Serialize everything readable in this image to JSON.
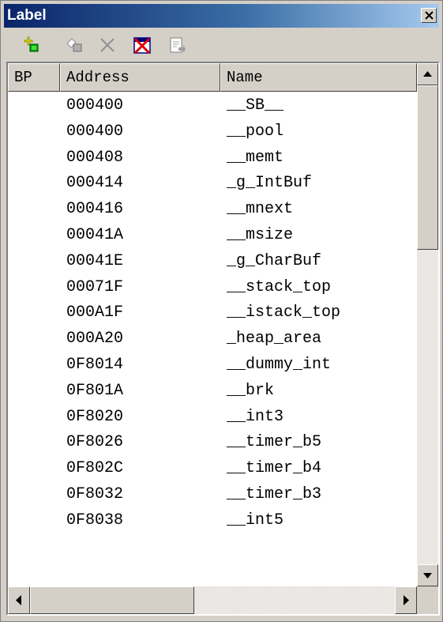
{
  "window": {
    "title": "Label"
  },
  "toolbar": {
    "icons": [
      "add-label-icon",
      "edit-label-icon",
      "delete-label-icon",
      "delete-all-icon",
      "export-icon"
    ]
  },
  "table": {
    "columns": [
      "BP",
      "Address",
      "Name"
    ],
    "rows": [
      {
        "bp": "",
        "address": "000400",
        "name": "__SB__"
      },
      {
        "bp": "",
        "address": "000400",
        "name": "__pool"
      },
      {
        "bp": "",
        "address": "000408",
        "name": "__memt"
      },
      {
        "bp": "",
        "address": "000414",
        "name": "_g_IntBuf"
      },
      {
        "bp": "",
        "address": "000416",
        "name": "__mnext"
      },
      {
        "bp": "",
        "address": "00041A",
        "name": "__msize"
      },
      {
        "bp": "",
        "address": "00041E",
        "name": "_g_CharBuf"
      },
      {
        "bp": "",
        "address": "00071F",
        "name": "__stack_top"
      },
      {
        "bp": "",
        "address": "000A1F",
        "name": "__istack_top"
      },
      {
        "bp": "",
        "address": "000A20",
        "name": "_heap_area"
      },
      {
        "bp": "",
        "address": "0F8014",
        "name": "__dummy_int"
      },
      {
        "bp": "",
        "address": "0F801A",
        "name": "__brk"
      },
      {
        "bp": "",
        "address": "0F8020",
        "name": "__int3"
      },
      {
        "bp": "",
        "address": "0F8026",
        "name": "__timer_b5"
      },
      {
        "bp": "",
        "address": "0F802C",
        "name": "__timer_b4"
      },
      {
        "bp": "",
        "address": "0F8032",
        "name": "__timer_b3"
      },
      {
        "bp": "",
        "address": "0F8038",
        "name": "__int5"
      }
    ]
  },
  "colors": {
    "titlebar_start": "#0a246a",
    "titlebar_end": "#a6caf0",
    "face": "#d4d0c8"
  }
}
